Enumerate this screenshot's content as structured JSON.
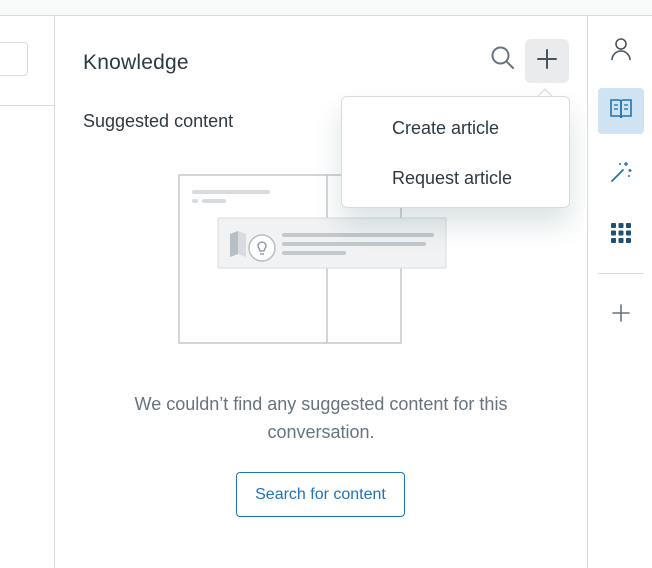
{
  "panel": {
    "title": "Knowledge",
    "suggested_heading": "Suggested content",
    "empty_message": "We couldn’t find any suggested content for this conversation.",
    "search_button_label": "Search for content"
  },
  "add_menu": {
    "items": [
      {
        "label": "Create article"
      },
      {
        "label": "Request article"
      }
    ]
  },
  "icons": {
    "search": "search-icon",
    "add": "plus-icon",
    "user": "user-icon",
    "knowledge": "book-icon",
    "magic": "magic-wand-icon",
    "apps": "grid-icon",
    "add_app": "plus-icon"
  },
  "colors": {
    "accent": "#1f73b7",
    "active_nav_bg": "#cfe3f2",
    "border": "#d8dcde",
    "muted_text": "#68737d"
  }
}
